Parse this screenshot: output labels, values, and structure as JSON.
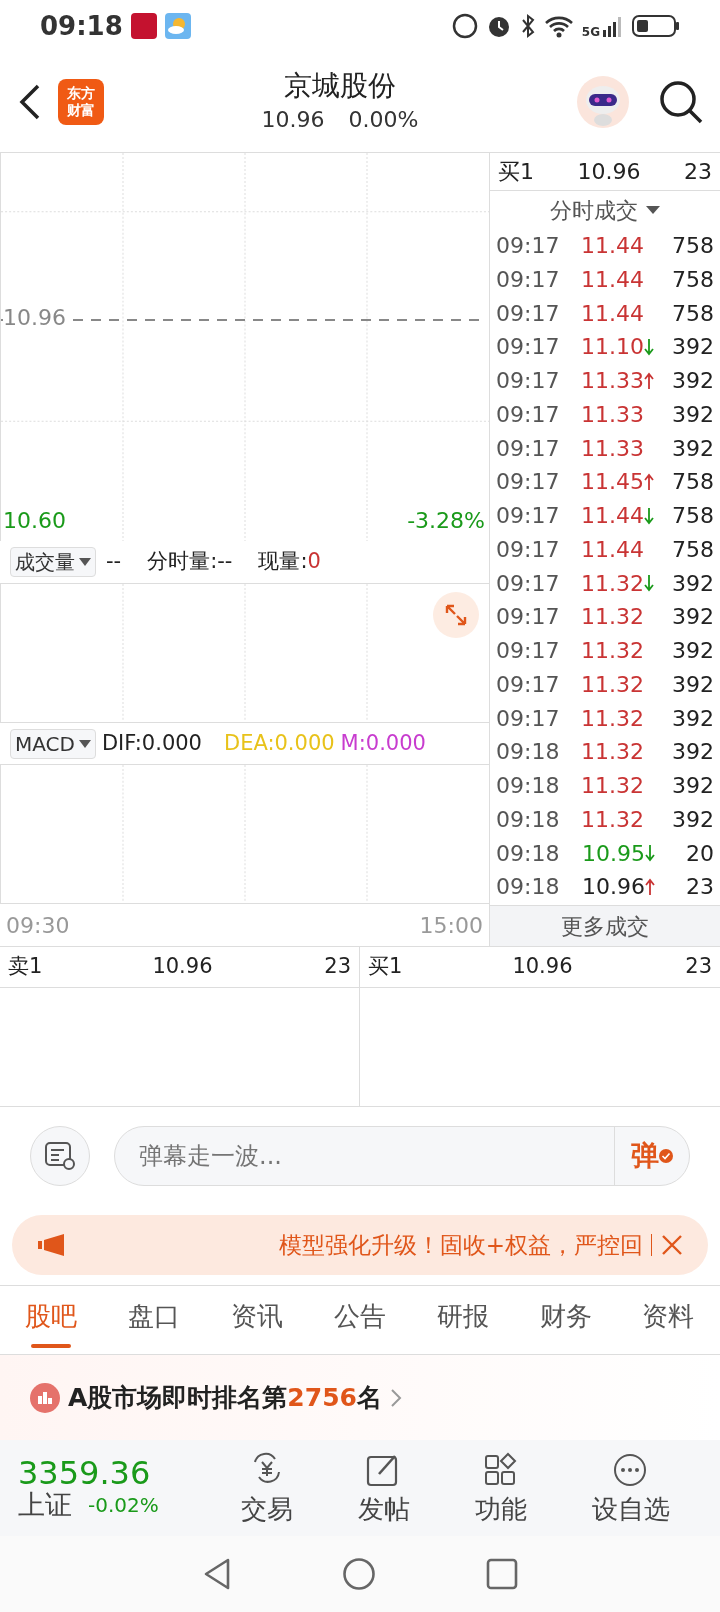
{
  "status_bar": {
    "time": "09:18",
    "network": "5G"
  },
  "header": {
    "logo": [
      "东方",
      "财富"
    ],
    "title": "京城股份",
    "price": "10.96",
    "change": "0.00%"
  },
  "chart": {
    "price_ref": "10.96",
    "price_low": "10.60",
    "pct_low": "-3.28%",
    "time_start": "09:30",
    "time_end": "15:00",
    "volume_bar": {
      "indicator": "成交量",
      "value": "--",
      "minute_label": "分时量:",
      "minute_value": "--",
      "current_label": "现量:",
      "current_value": "0"
    },
    "macd_bar": {
      "indicator": "MACD",
      "dif": "DIF:0.000",
      "dea": "DEA:0.000",
      "m": "M:0.000"
    }
  },
  "trades_panel": {
    "best_bid": {
      "label": "买1",
      "price": "10.96",
      "volume": "23"
    },
    "mode": "分时成交",
    "more": "更多成交",
    "rows": [
      {
        "time": "09:17",
        "price": "11.44",
        "volume": "758",
        "color": "#c93434",
        "kind": "plain"
      },
      {
        "time": "09:17",
        "price": "11.44",
        "volume": "758",
        "color": "#c93434",
        "kind": "plain"
      },
      {
        "time": "09:17",
        "price": "11.44",
        "volume": "758",
        "color": "#c93434",
        "kind": "plain"
      },
      {
        "time": "09:17",
        "price": "11.10",
        "volume": "392",
        "color": "#c93434",
        "kind": "down"
      },
      {
        "time": "09:17",
        "price": "11.33",
        "volume": "392",
        "color": "#c93434",
        "kind": "up"
      },
      {
        "time": "09:17",
        "price": "11.33",
        "volume": "392",
        "color": "#c93434",
        "kind": "plain"
      },
      {
        "time": "09:17",
        "price": "11.33",
        "volume": "392",
        "color": "#c93434",
        "kind": "plain"
      },
      {
        "time": "09:17",
        "price": "11.45",
        "volume": "758",
        "color": "#c93434",
        "kind": "up"
      },
      {
        "time": "09:17",
        "price": "11.44",
        "volume": "758",
        "color": "#c93434",
        "kind": "down"
      },
      {
        "time": "09:17",
        "price": "11.44",
        "volume": "758",
        "color": "#c93434",
        "kind": "plain"
      },
      {
        "time": "09:17",
        "price": "11.32",
        "volume": "392",
        "color": "#c93434",
        "kind": "down"
      },
      {
        "time": "09:17",
        "price": "11.32",
        "volume": "392",
        "color": "#c93434",
        "kind": "plain"
      },
      {
        "time": "09:17",
        "price": "11.32",
        "volume": "392",
        "color": "#c93434",
        "kind": "plain"
      },
      {
        "time": "09:17",
        "price": "11.32",
        "volume": "392",
        "color": "#c93434",
        "kind": "plain"
      },
      {
        "time": "09:17",
        "price": "11.32",
        "volume": "392",
        "color": "#c93434",
        "kind": "plain"
      },
      {
        "time": "09:18",
        "price": "11.32",
        "volume": "392",
        "color": "#c93434",
        "kind": "plain"
      },
      {
        "time": "09:18",
        "price": "11.32",
        "volume": "392",
        "color": "#c93434",
        "kind": "plain"
      },
      {
        "time": "09:18",
        "price": "11.32",
        "volume": "392",
        "color": "#c93434",
        "kind": "plain"
      },
      {
        "time": "09:18",
        "price": "10.95",
        "volume": "20",
        "color": "#1a9a1a",
        "kind": "down"
      },
      {
        "time": "09:18",
        "price": "10.96",
        "volume": "23",
        "color": "#222222",
        "kind": "up"
      }
    ]
  },
  "order_book": {
    "ask": {
      "label": "卖1",
      "price": "10.96",
      "volume": "23"
    },
    "bid": {
      "label": "买1",
      "price": "10.96",
      "volume": "23"
    }
  },
  "danmaku": {
    "placeholder": "弹幕走一波...",
    "send": "弹"
  },
  "notice": {
    "text": "模型强化升级！固收+权益，严控回"
  },
  "tabs": [
    {
      "label": "股吧",
      "selected": true
    },
    {
      "label": "盘口",
      "selected": false
    },
    {
      "label": "资讯",
      "selected": false
    },
    {
      "label": "公告",
      "selected": false
    },
    {
      "label": "研报",
      "selected": false
    },
    {
      "label": "财务",
      "selected": false
    },
    {
      "label": "资料",
      "selected": false
    }
  ],
  "rank": {
    "prefix": "A股市场即时排名第",
    "number": "2756",
    "suffix": "名"
  },
  "index_ticker": {
    "value": "3359.36",
    "name": "上证",
    "change": "-0.02%"
  },
  "actions": [
    {
      "label": "交易",
      "kind": "trade"
    },
    {
      "label": "发帖",
      "kind": "post"
    },
    {
      "label": "功能",
      "kind": "grid"
    },
    {
      "label": "设自选",
      "kind": "more"
    }
  ]
}
